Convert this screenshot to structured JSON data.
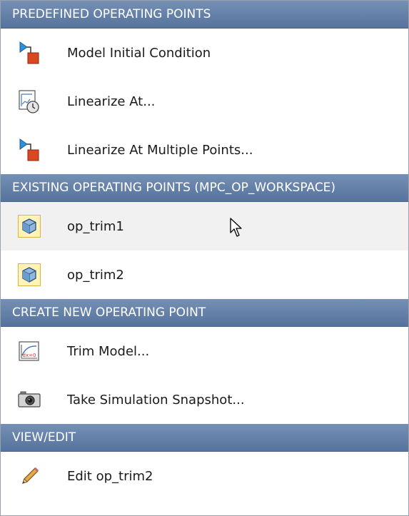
{
  "sections": {
    "predefined": {
      "header": "PREDEFINED OPERATING POINTS",
      "items": [
        {
          "label": "Model Initial Condition",
          "icon": "model-block-icon"
        },
        {
          "label": "Linearize At...",
          "icon": "time-snapshot-icon"
        },
        {
          "label": "Linearize At Multiple Points...",
          "icon": "model-block-icon"
        }
      ]
    },
    "existing": {
      "header": "EXISTING OPERATING POINTS (MPC_OP_WORKSPACE)",
      "items": [
        {
          "label": "op_trim1",
          "icon": "operating-point-cube-icon"
        },
        {
          "label": "op_trim2",
          "icon": "operating-point-cube-icon"
        }
      ]
    },
    "create": {
      "header": "CREATE NEW OPERATING POINT",
      "items": [
        {
          "label": "Trim Model...",
          "icon": "trim-dx0-icon",
          "icon_text": "dx=0"
        },
        {
          "label": "Take Simulation Snapshot...",
          "icon": "camera-icon"
        }
      ]
    },
    "view_edit": {
      "header": "VIEW/EDIT",
      "items": [
        {
          "label": "Edit op_trim2",
          "icon": "pencil-icon"
        }
      ]
    }
  },
  "colors": {
    "header_bg": "#5e7aa3",
    "hover_bg": "#f1f1f1",
    "selected_icon_bg": "#fff3b8",
    "accent_red": "#d9481f",
    "accent_blue": "#2f8fd8"
  }
}
